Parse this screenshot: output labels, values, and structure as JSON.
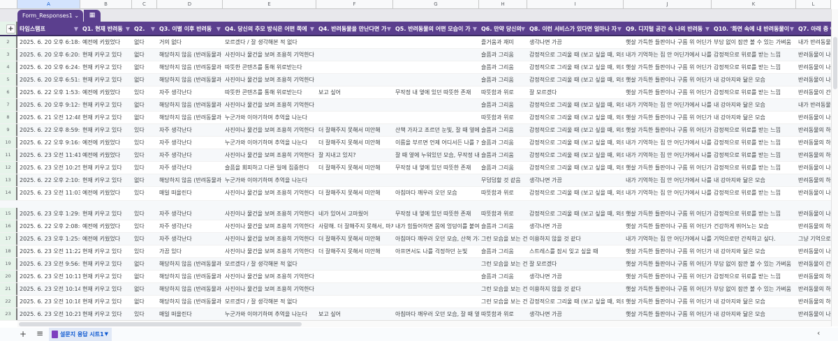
{
  "column_letters": [
    "A",
    "B",
    "C",
    "D",
    "E",
    "F",
    "G",
    "H",
    "I",
    "J",
    "K",
    "L"
  ],
  "table_tab": {
    "name": "Form_Responses1",
    "dropdown_icon": "chevron-down-icon",
    "icon": "form-table-icon"
  },
  "headers": [
    "타임스탬프",
    "Q1. 현재 반려동",
    "Q2.",
    "Q3. 이별 이후 반려동",
    "Q4. 당신의 추모 방식은 어떤 쪽에",
    "Q4. 반려동물을 만난다면 가",
    "Q5. 반려동물의 어떤 모습이 가",
    "Q6. 만약 당신의",
    "Q8. 이런 서비스가 있다면 얼마나 자",
    "Q9. 디지털 공간 속 나의 반려동",
    "Q10. '화면 속에 내 반려동물이",
    "Q7. 아래 중 어"
  ],
  "row_numbers": [
    "1",
    "2",
    "3",
    "4",
    "5",
    "6",
    "7",
    "8",
    "9",
    "10",
    "11",
    "12",
    "13",
    "14",
    "15",
    "16",
    "17",
    "18",
    "19",
    "20",
    "21",
    "22",
    "23"
  ],
  "rows": [
    [
      "2025. 6. 20 오후 6:18:49",
      "예전에 키웠었다",
      "없다",
      "거의 없다",
      "모르겠다 / 잘 생각해본 적 없다",
      "",
      "",
      "즐거움과 재미",
      "생각나면 가끔",
      "햇살 가득한 들판이나 구름 위 어딘가",
      "부담 없이 잠깐 볼 수 있는 가벼움",
      "내가 반려동물"
    ],
    [
      "2025. 6. 20 오후 6:20:31",
      "현재 키우고 있다",
      "없다",
      "해당하지 않음 (반려동물과",
      "사진이나 물건을 보며 조용히 기억한다",
      "",
      "",
      "슬픔과 그리움",
      "감정적으로 그리울 때 (보고 싶을 때, 외로",
      "내가 기억하는 집 안 어딘가에서 나를",
      "감정적으로 위로를 받는 느낌",
      "반려동물이 나"
    ],
    [
      "2025. 6. 20 오후 6:24:45",
      "현재 키우고 있다",
      "없다",
      "해당하지 않음 (반려동물과",
      "따뜻한 콘텐츠를 통해 위로받는다",
      "",
      "",
      "슬픔과 그리움",
      "감정적으로 그리울 때 (보고 싶을 때, 외로",
      "햇살 가득한 들판이나 구름 위 어딘가",
      "감정적으로 위로를 받는 느낌",
      "반려동물이 나"
    ],
    [
      "2025. 6. 20 오후 6:51:58",
      "현재 키우고 있다",
      "없다",
      "해당하지 않음 (반려동물과",
      "사진이나 물건을 보며 조용히 기억한다",
      "",
      "",
      "슬픔과 그리움",
      "감정적으로 그리울 때 (보고 싶을 때, 외로",
      "햇살 가득한 들판이나 구름 위 어딘가",
      "내 강아지와 닮은 모습",
      "반려동물이 나"
    ],
    [
      "2025. 6. 22 오후 1:53:43",
      "예전에 키웠었다",
      "있다",
      "자주 생각난다",
      "따뜻한 콘텐츠를 통해 위로받는다",
      "보고 싶어",
      "무작정 내 옆에 있던 따뜻한 존재",
      "따뜻함과 위로",
      "잘 모르겠다",
      "햇살 가득한 들판이나 구름 위 어딘가",
      "감정적으로 위로를 받는 느낌",
      "반려동물이 간"
    ],
    [
      "2025. 6. 20 오후 9:12:08",
      "현재 키우고 있다",
      "없다",
      "해당하지 않음 (반려동물과",
      "사진이나 물건을 보며 조용히 기억한다",
      "",
      "",
      "슬픔과 그리움",
      "감정적으로 그리울 때 (보고 싶을 때, 외로",
      "내가 기억하는 집 안 어딘가에서 나를",
      "내 강아지와 닮은 모습",
      "내가 반려동물"
    ],
    [
      "2025. 6. 21 오전 12:48:1",
      "현재 키우고 있다",
      "없다",
      "해당하지 않음 (반려동물과",
      "누군가와 이야기하며 추억을 나눈다",
      "",
      "",
      "따뜻함과 위로",
      "감정적으로 그리울 때 (보고 싶을 때, 외로",
      "햇살 가득한 들판이나 구름 위 어딘가",
      "내 강아지와 닮은 모습",
      "반려동물이 나"
    ],
    [
      "2025. 6. 22 오후 8:59:17",
      "현재 키우고 있다",
      "있다",
      "자주 생각난다",
      "사진이나 물건을 보며 조용히 기억한다",
      "더 잘해주지 못해서 미안해",
      "산책 가자고 조르던 눈빛, 잘 때 옆에",
      "슬픔과 그리움",
      "감정적으로 그리울 때 (보고 싶을 때, 외로",
      "햇살 가득한 들판이나 구름 위 어딘가",
      "감정적으로 위로를 받는 느낌",
      "반려동물의 하"
    ],
    [
      "2025. 6. 22 오후 9:16:08",
      "예전에 키웠었다",
      "있다",
      "자주 생각난다",
      "누군가와 이야기하며 추억을 나눈다",
      "더 잘해주지 못해서 미안해",
      "이름을 부르면 언제 어디서든 나를 ?",
      "슬픔과 그리움",
      "감정적으로 그리울 때 (보고 싶을 때, 외로",
      "내가 기억하는 집 안 어딘가에서 나를",
      "감정적으로 위로를 받는 느낌",
      "반려동물의 하"
    ],
    [
      "2025. 6. 23 오전 11:41:3",
      "예전에 키웠었다",
      "있다",
      "자주 생각난다",
      "사진이나 물건을 보며 조용히 기억한다",
      "잘 지내고 있지?",
      "잘 때 옆에 누워있던 모습, 무작정 내",
      "슬픔과 그리움",
      "감정적으로 그리울 때 (보고 싶을 때, 외로",
      "내가 기억하는 집 안 어딘가에서 나를",
      "감정적으로 위로를 받는 느낌",
      "반려동물의 하"
    ],
    [
      "2025. 6. 23 오전 10:25:3",
      "현재 키우고 있다",
      "있다",
      "자주 생각난다",
      "슬픔을 회피하고 다른 일에 집중한다",
      "더 잘해주지 못해서 미안해",
      "무작정 내 옆에 있던 따뜻한 존재",
      "슬픔과 그리움",
      "감정적으로 그리울 때 (보고 싶을 때, 외로",
      "햇살 가득한 들판이나 구름 위 어딘가",
      "감정적으로 위로를 받는 느낌",
      "반려동물이 나"
    ],
    [
      "2025. 6. 22 오후 2:10:20",
      "현재 키우고 있다",
      "없다",
      "해당하지 않음 (반려동물과",
      "누군가와 이야기하며 추억을 나눈다",
      "",
      "",
      "무덤덤할 것 같음",
      "생각나면 가끔",
      "내가 기억하는 집 안 어딘가에서 나를",
      "내 강아지와 닮은 모습",
      "반려동물의 하"
    ],
    [
      "2025. 6. 23 오전 11:03:1",
      "예전에 키웠었다",
      "있다",
      "매일 떠올린다",
      "사진이나 물건을 보며 조용히 기억한다",
      "더 잘해주지 못해서 미안해",
      "아침마다 깨우러 오던 모습",
      "따뜻함과 위로",
      "감정적으로 그리울 때 (보고 싶을 때, 외로",
      "내가 기억하는 집 안 어딘가에서 나를",
      "감정적으로 위로를 받는 느낌",
      "반려동물이 나"
    ],
    [
      "2025. 6. 23 오후 1:29:37",
      "현재 키우고 있다",
      "있다",
      "자주 생각난다",
      "사진이나 물건을 보며 조용히 기억한다",
      "네가 있어서 고마웠어",
      "무작정 내 옆에 있던 따뜻한 존재",
      "따뜻함과 위로",
      "감정적으로 그리울 때 (보고 싶을 때, 외로",
      "햇살 가득한 들판이나 구름 위 어딘가",
      "감정적으로 위로를 받는 느낌",
      "반려동물이 나"
    ],
    [
      "2025. 6. 22 오후 2:08:40",
      "예전에 키웠었다",
      "있다",
      "자주 생각난다",
      "사진이나 물건을 보며 조용히 기억한다",
      "사랑해. 더 잘해주지 못해서, 마지",
      "내가 힘들어하면 몸에 엉덩이를 붙여",
      "슬픔과 그리움",
      "생각나면 가끔",
      "햇살 가득한 들판이나 구름 위 어딘가",
      "건강하게 뛰어노는 모습",
      "반려동물의 하"
    ],
    [
      "2025. 6. 23 오후 1:25:05",
      "예전에 키웠었다",
      "있다",
      "자주 생각난다",
      "사진이나 물건을 보며 조용히 기억한다",
      "더 잘해주지 못해서 미안해",
      "아침마다 깨우러 오던 모습, 산책 가자",
      "그런 모습을 보는 건",
      "이용하지 않을 것 같다",
      "내가 기억하는 집 안 어딘가에서 나를",
      "기억으로만 간직하고 싶다.",
      "그냥 기억으로"
    ],
    [
      "2025. 6. 23 오전 11:22:4",
      "현재 키우고 있다",
      "있다",
      "가끔 있다",
      "사진이나 물건을 보며 조용히 기억한다",
      "더 잘해주지 못해서 미안해",
      "아프면서도 나를 걱정하던 눈빛",
      "슬픔과 그리움",
      "스트레스를 잠시 잊고 싶을 때",
      "햇살 가득한 들판이나 구름 위 어딘가",
      "내 강아지와 닮은 모습",
      "반려동물이 나"
    ],
    [
      "2025. 6. 23 오전 9:56:22",
      "현재 키우고 있다",
      "없다",
      "해당하지 않음 (반려동물과",
      "모르겠다 / 잘 생각해본 적 없다",
      "",
      "",
      "그런 모습을 보는 건",
      "잘 모르겠다",
      "햇살 가득한 들판이나 구름 위 어딘가",
      "부담 없이 잠깐 볼 수 있는 가벼움",
      "반려동물이 간"
    ],
    [
      "2025. 6. 23 오전 10:11:1",
      "현재 키우고 있다",
      "없다",
      "해당하지 않음 (반려동물과",
      "사진이나 물건을 보며 조용히 기억한다",
      "",
      "",
      "슬픔과 그리움",
      "생각나면 가끔",
      "햇살 가득한 들판이나 구름 위 어딘가",
      "감정적으로 위로를 받는 느낌",
      "반려동물의 하"
    ],
    [
      "2025. 6. 23 오전 10:14:2",
      "현재 키우고 있다",
      "없다",
      "해당하지 않음 (반려동물과",
      "사진이나 물건을 보며 조용히 기억한다",
      "",
      "",
      "그런 모습을 보는 건",
      "이용하지 않을 것 같다",
      "햇살 가득한 들판이나 구름 위 어딘가",
      "부담 없이 잠깐 볼 수 있는 가벼움",
      "반려동물의 하"
    ],
    [
      "2025. 6. 23 오전 10:18:0",
      "현재 키우고 있다",
      "없다",
      "해당하지 않음 (반려동물과",
      "모르겠다 / 잘 생각해본 적 없다",
      "",
      "",
      "그런 모습을 보는 건",
      "감정적으로 그리울 때 (보고 싶을 때, 외로",
      "햇살 가득한 들판이나 구름 위 어딘가",
      "내 강아지와 닮은 모습",
      "반려동물의 하"
    ],
    [
      "2025. 6. 23 오전 10:21:3",
      "현재 키우고 있다",
      "있다",
      "매일 떠올린다",
      "누군가와 이야기하며 추억을 나눈다",
      "보고 싶어",
      "아침마다 깨우러 오던 모습, 잘 때 옆",
      "따뜻함과 위로",
      "생각나면 가끔",
      "햇살 가득한 들판이나 구름 위 어딘가",
      "내 강아지와 닮은 모습",
      "반려동물이 나"
    ]
  ],
  "bottom_bar": {
    "add_sheet": "+",
    "all_sheets": "≡",
    "sheet_tab": "설문지 응답 시트1",
    "collapse": "‹"
  },
  "colors": {
    "header_bg": "#5b3f8e",
    "row_alt": "#f6f8fa"
  }
}
